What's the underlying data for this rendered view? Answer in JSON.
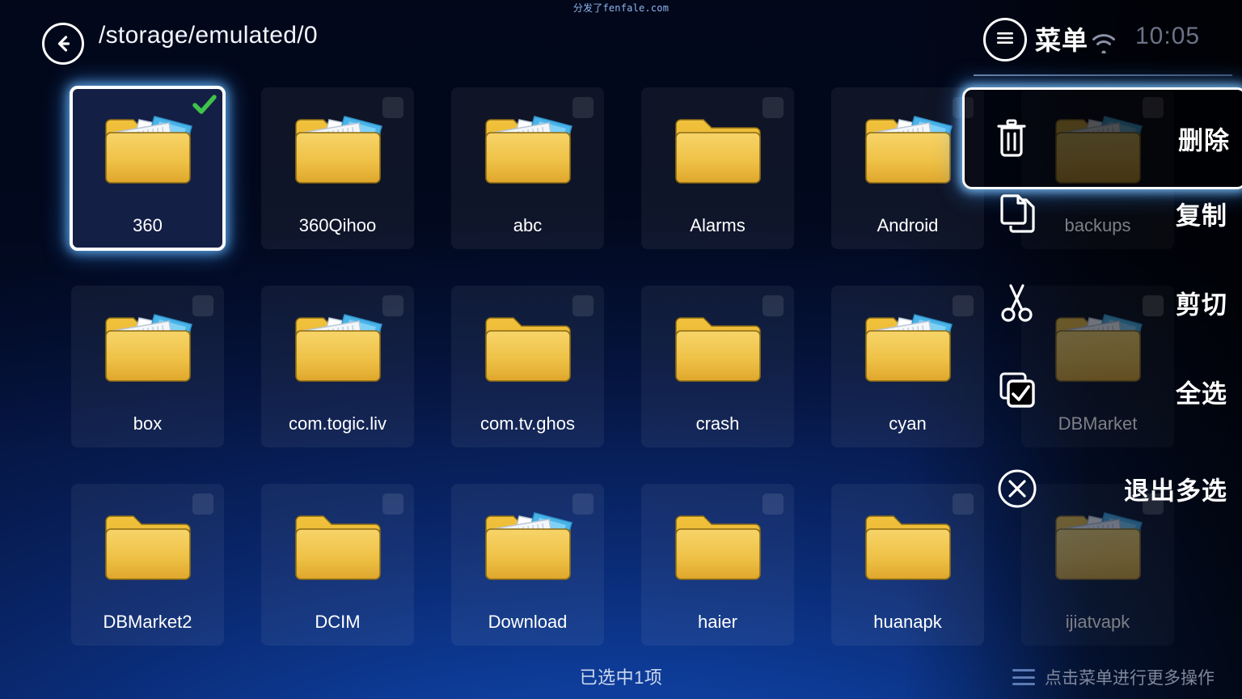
{
  "watermark": "分发了fenfale.com",
  "header": {
    "back_icon": "back-arrow-icon",
    "path": "/storage/emulated/0",
    "menu_icon": "hamburger-menu-icon",
    "menu_label": "菜单",
    "wifi_icon": "wifi-icon",
    "clock": "10:05"
  },
  "grid": {
    "rows": [
      [
        {
          "name": "360",
          "icon": "folder-with-files-icon",
          "selected": true,
          "dim": false
        },
        {
          "name": "360Qihoo",
          "icon": "folder-with-files-icon",
          "selected": false,
          "dim": false
        },
        {
          "name": "abc",
          "icon": "folder-with-files-icon",
          "selected": false,
          "dim": false
        },
        {
          "name": "Alarms",
          "icon": "folder-empty-icon",
          "selected": false,
          "dim": false
        },
        {
          "name": "Android",
          "icon": "folder-with-files-icon",
          "selected": false,
          "dim": false
        },
        {
          "name": "backups",
          "icon": "folder-with-files-icon",
          "selected": false,
          "dim": true
        }
      ],
      [
        {
          "name": "box",
          "icon": "folder-with-files-icon",
          "selected": false,
          "dim": false
        },
        {
          "name": "com.togic.liv",
          "icon": "folder-with-files-icon",
          "selected": false,
          "dim": false
        },
        {
          "name": "com.tv.ghos",
          "icon": "folder-empty-icon",
          "selected": false,
          "dim": false
        },
        {
          "name": "crash",
          "icon": "folder-empty-icon",
          "selected": false,
          "dim": false
        },
        {
          "name": "cyan",
          "icon": "folder-with-files-icon",
          "selected": false,
          "dim": false
        },
        {
          "name": "DBMarket",
          "icon": "folder-with-files-icon",
          "selected": false,
          "dim": true
        }
      ],
      [
        {
          "name": "DBMarket2",
          "icon": "folder-empty-icon",
          "selected": false,
          "dim": false
        },
        {
          "name": "DCIM",
          "icon": "folder-empty-icon",
          "selected": false,
          "dim": false
        },
        {
          "name": "Download",
          "icon": "folder-with-files-icon",
          "selected": false,
          "dim": false
        },
        {
          "name": "haier",
          "icon": "folder-empty-icon",
          "selected": false,
          "dim": false
        },
        {
          "name": "huanapk",
          "icon": "folder-empty-icon",
          "selected": false,
          "dim": false
        },
        {
          "name": "ijiatvapk",
          "icon": "folder-with-files-icon",
          "selected": false,
          "dim": true
        }
      ]
    ]
  },
  "menu": {
    "items": [
      {
        "label": "删除",
        "icon": "trash-icon",
        "focused": true
      },
      {
        "label": "复制",
        "icon": "copy-icon",
        "focused": false
      },
      {
        "label": "剪切",
        "icon": "scissors-icon",
        "focused": false
      },
      {
        "label": "全选",
        "icon": "select-all-icon",
        "focused": false
      },
      {
        "label": "退出多选",
        "icon": "close-circle-icon",
        "focused": false
      }
    ]
  },
  "footer": {
    "selection_status": "已选中1项",
    "hint_icon": "hamburger-menu-icon",
    "hint": "点击菜单进行更多操作"
  },
  "colors": {
    "accent_glow": "#6ebeff",
    "folder": "#eec košte",
    "folder_yellow": "#f0c64a",
    "check_green": "#3fc24a",
    "text": "#ffffff"
  }
}
